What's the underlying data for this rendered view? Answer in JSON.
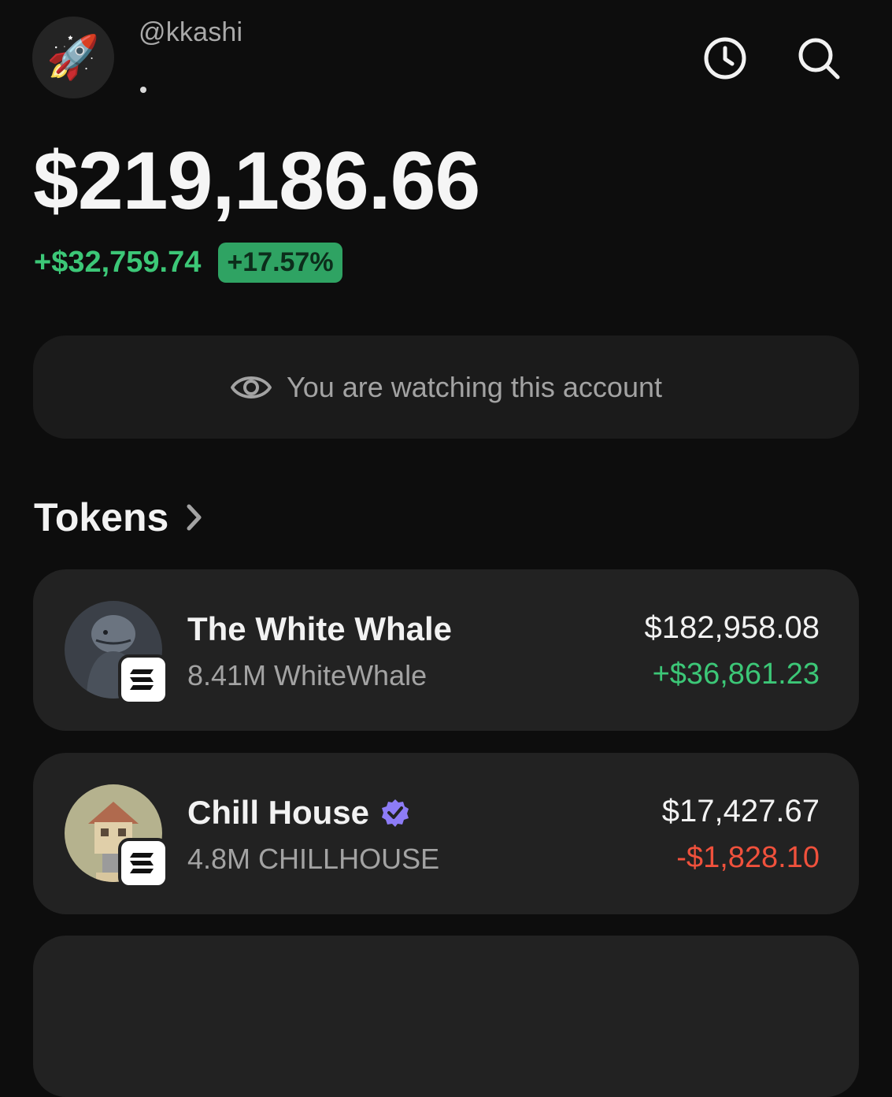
{
  "profile": {
    "avatar_emoji": "🚀",
    "username": "@kkashi"
  },
  "header": {
    "history_icon": "clock-icon",
    "search_icon": "search-icon"
  },
  "portfolio": {
    "balance": "$219,186.66",
    "change_amount": "+$32,759.74",
    "change_percent": "+17.57%"
  },
  "watch_banner": {
    "icon": "eye-icon",
    "text": "You are watching this account"
  },
  "tokens": {
    "heading": "Tokens",
    "items": [
      {
        "name": "The White Whale",
        "amount": "8.41M WhiteWhale",
        "value": "$182,958.08",
        "pnl": "+$36,861.23",
        "pnl_trend": "positive",
        "verified": false,
        "chain_icon": "solana-icon"
      },
      {
        "name": "Chill House",
        "amount": "4.8M CHILLHOUSE",
        "value": "$17,427.67",
        "pnl": "-$1,828.10",
        "pnl_trend": "negative",
        "verified": true,
        "chain_icon": "solana-icon"
      }
    ]
  },
  "colors": {
    "background": "#0d0d0d",
    "card": "#222222",
    "positive": "#3cc777",
    "negative": "#f0513c",
    "badge": "#2fa363",
    "verified": "#8d7cf6"
  }
}
